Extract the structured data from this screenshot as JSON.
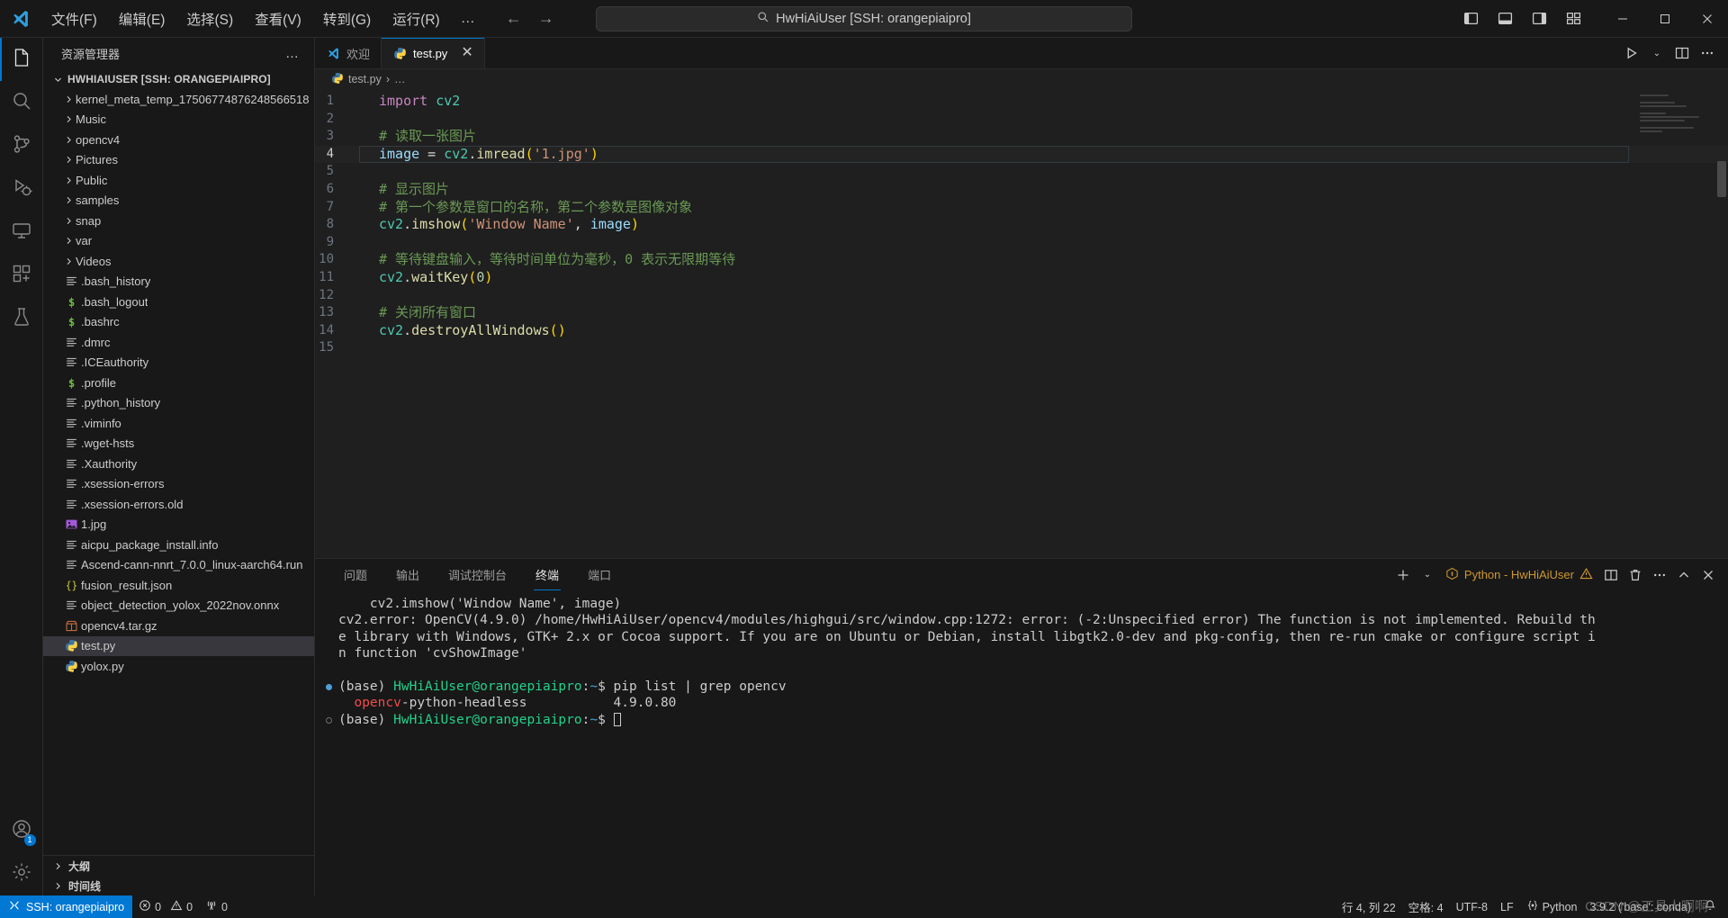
{
  "titlebar": {
    "logo_icon": "vscode-logo-icon",
    "menu": [
      {
        "label": "文件(F)",
        "name": "menu-file"
      },
      {
        "label": "编辑(E)",
        "name": "menu-edit"
      },
      {
        "label": "选择(S)",
        "name": "menu-selection"
      },
      {
        "label": "查看(V)",
        "name": "menu-view"
      },
      {
        "label": "转到(G)",
        "name": "menu-go"
      },
      {
        "label": "运行(R)",
        "name": "menu-run"
      }
    ],
    "menu_more": "…",
    "nav_back": "←",
    "nav_forward": "→",
    "search_text": "HwHiAiUser [SSH: orangepiaipro]",
    "search_placeholder": "HwHiAiUser [SSH: orangepiaipro]",
    "window_controls": {
      "minimize": "–",
      "maximize": "□",
      "close": "✕"
    }
  },
  "activitybar": {
    "items": [
      {
        "name": "explorer",
        "icon": "files-icon",
        "active": true
      },
      {
        "name": "search",
        "icon": "search-icon",
        "active": false
      },
      {
        "name": "source-control",
        "icon": "source-control-icon",
        "active": false
      },
      {
        "name": "run-and-debug",
        "icon": "run-debug-icon",
        "active": false
      },
      {
        "name": "remote-explorer",
        "icon": "remote-explorer-icon",
        "active": false
      },
      {
        "name": "extensions",
        "icon": "extensions-icon",
        "active": false
      },
      {
        "name": "testing",
        "icon": "beaker-icon",
        "active": false
      }
    ],
    "accounts_badge": "1"
  },
  "sidebar": {
    "title": "资源管理器",
    "more_actions": "…",
    "root_label": "HWHIAIUSER [SSH: ORANGEPIAIPRO]",
    "folders": [
      {
        "name": "kernel_meta_temp_17506774876248566518"
      },
      {
        "name": "Music"
      },
      {
        "name": "opencv4"
      },
      {
        "name": "Pictures"
      },
      {
        "name": "Public"
      },
      {
        "name": "samples"
      },
      {
        "name": "snap"
      },
      {
        "name": "var"
      },
      {
        "name": "Videos"
      }
    ],
    "files": [
      {
        "name": ".bash_history",
        "icon": "text-file-icon",
        "selected": false
      },
      {
        "name": ".bash_logout",
        "icon": "shell-file-icon",
        "selected": false
      },
      {
        "name": ".bashrc",
        "icon": "shell-file-icon",
        "selected": false
      },
      {
        "name": ".dmrc",
        "icon": "text-file-icon",
        "selected": false
      },
      {
        "name": ".ICEauthority",
        "icon": "text-file-icon",
        "selected": false
      },
      {
        "name": ".profile",
        "icon": "shell-file-icon",
        "selected": false
      },
      {
        "name": ".python_history",
        "icon": "text-file-icon",
        "selected": false
      },
      {
        "name": ".viminfo",
        "icon": "text-file-icon",
        "selected": false
      },
      {
        "name": ".wget-hsts",
        "icon": "text-file-icon",
        "selected": false
      },
      {
        "name": ".Xauthority",
        "icon": "text-file-icon",
        "selected": false
      },
      {
        "name": ".xsession-errors",
        "icon": "text-file-icon",
        "selected": false
      },
      {
        "name": ".xsession-errors.old",
        "icon": "text-file-icon",
        "selected": false
      },
      {
        "name": "1.jpg",
        "icon": "image-file-icon",
        "selected": false
      },
      {
        "name": "aicpu_package_install.info",
        "icon": "text-file-icon",
        "selected": false
      },
      {
        "name": "Ascend-cann-nnrt_7.0.0_linux-aarch64.run",
        "icon": "text-file-icon",
        "selected": false
      },
      {
        "name": "fusion_result.json",
        "icon": "json-file-icon",
        "selected": false
      },
      {
        "name": "object_detection_yolox_2022nov.onnx",
        "icon": "text-file-icon",
        "selected": false
      },
      {
        "name": "opencv4.tar.gz",
        "icon": "archive-file-icon",
        "selected": false
      },
      {
        "name": "test.py",
        "icon": "python-file-icon",
        "selected": true
      },
      {
        "name": "yolox.py",
        "icon": "python-file-icon",
        "selected": false
      }
    ],
    "sections": [
      {
        "label": "大纲",
        "name": "outline-section"
      },
      {
        "label": "时间线",
        "name": "timeline-section"
      }
    ]
  },
  "editor": {
    "tabs": [
      {
        "label": "欢迎",
        "icon": "vscode-logo-icon",
        "active": false,
        "closable": false
      },
      {
        "label": "test.py",
        "icon": "python-file-icon",
        "active": true,
        "closable": true
      }
    ],
    "tab_close": "✕",
    "actions": [
      {
        "name": "run-python-file-button",
        "icon": "play-icon"
      },
      {
        "name": "run-options-chevron",
        "icon": "chevron-down-icon"
      },
      {
        "name": "split-editor-button",
        "icon": "split-editor-icon"
      },
      {
        "name": "more-actions-button",
        "icon": "ellipsis-icon"
      }
    ],
    "breadcrumb": {
      "file": "test.py",
      "separator": "›",
      "symbol": "…",
      "icon": "python-file-icon"
    },
    "lines": [
      {
        "num": "1",
        "tokens": [
          {
            "t": "import",
            "c": "k"
          },
          {
            "t": " ",
            "c": "p"
          },
          {
            "t": "cv2",
            "c": "id"
          }
        ]
      },
      {
        "num": "2",
        "tokens": []
      },
      {
        "num": "3",
        "tokens": [
          {
            "t": "# 读取一张图片",
            "c": "c"
          }
        ]
      },
      {
        "num": "4",
        "tokens": [
          {
            "t": "image",
            "c": "v"
          },
          {
            "t": " = ",
            "c": "p"
          },
          {
            "t": "cv2",
            "c": "id"
          },
          {
            "t": ".",
            "c": "p"
          },
          {
            "t": "imread",
            "c": "fn"
          },
          {
            "t": "(",
            "c": "br"
          },
          {
            "t": "'1.jpg'",
            "c": "s"
          },
          {
            "t": ")",
            "c": "br"
          }
        ],
        "current": true
      },
      {
        "num": "5",
        "tokens": []
      },
      {
        "num": "6",
        "tokens": [
          {
            "t": "# 显示图片",
            "c": "c"
          }
        ]
      },
      {
        "num": "7",
        "tokens": [
          {
            "t": "# 第一个参数是窗口的名称，第二个参数是图像对象",
            "c": "c"
          }
        ]
      },
      {
        "num": "8",
        "tokens": [
          {
            "t": "cv2",
            "c": "id"
          },
          {
            "t": ".",
            "c": "p"
          },
          {
            "t": "imshow",
            "c": "fn"
          },
          {
            "t": "(",
            "c": "br"
          },
          {
            "t": "'Window Name'",
            "c": "s"
          },
          {
            "t": ", ",
            "c": "p"
          },
          {
            "t": "image",
            "c": "v"
          },
          {
            "t": ")",
            "c": "br"
          }
        ]
      },
      {
        "num": "9",
        "tokens": []
      },
      {
        "num": "10",
        "tokens": [
          {
            "t": "# 等待键盘输入，等待时间单位为毫秒，",
            "c": "c"
          },
          {
            "t": "0",
            "c": "c"
          },
          {
            "t": " 表示无限期等待",
            "c": "c"
          }
        ]
      },
      {
        "num": "11",
        "tokens": [
          {
            "t": "cv2",
            "c": "id"
          },
          {
            "t": ".",
            "c": "p"
          },
          {
            "t": "waitKey",
            "c": "fn"
          },
          {
            "t": "(",
            "c": "br"
          },
          {
            "t": "0",
            "c": "n"
          },
          {
            "t": ")",
            "c": "br"
          }
        ]
      },
      {
        "num": "12",
        "tokens": []
      },
      {
        "num": "13",
        "tokens": [
          {
            "t": "# 关闭所有窗口",
            "c": "c"
          }
        ]
      },
      {
        "num": "14",
        "tokens": [
          {
            "t": "cv2",
            "c": "id"
          },
          {
            "t": ".",
            "c": "p"
          },
          {
            "t": "destroyAllWindows",
            "c": "fn"
          },
          {
            "t": "(",
            "c": "br"
          },
          {
            "t": ")",
            "c": "br"
          }
        ]
      },
      {
        "num": "15",
        "tokens": []
      }
    ]
  },
  "panel": {
    "tabs": [
      {
        "label": "问题",
        "name": "tab-problems",
        "active": false
      },
      {
        "label": "输出",
        "name": "tab-output",
        "active": false
      },
      {
        "label": "调试控制台",
        "name": "tab-debug-console",
        "active": false
      },
      {
        "label": "终端",
        "name": "tab-terminal",
        "active": true
      },
      {
        "label": "端口",
        "name": "tab-ports",
        "active": false
      }
    ],
    "actions": {
      "new_terminal": "+",
      "new_terminal_chevron": "chevron-down-icon",
      "terminal_name": "Python - HwHiAiUser",
      "warning_icon": "warning-icon",
      "split": "split-terminal-icon",
      "kill": "trash-icon",
      "more": "…",
      "maximize": "chevron-up-icon",
      "close": "✕"
    },
    "terminal_lines": [
      {
        "indent": 4,
        "segments": [
          {
            "t": "cv2.imshow('Window Name', image)",
            "c": ""
          }
        ]
      },
      {
        "segments": [
          {
            "t": "cv2.error: OpenCV(4.9.0) /home/HwHiAiUser/opencv4/modules/highgui/src/window.cpp:1272: error: (-2:Unspecified error) The function is not implemented. Rebuild th",
            "c": ""
          }
        ]
      },
      {
        "segments": [
          {
            "t": "e library with Windows, GTK+ 2.x or Cocoa support. If you are on Ubuntu or Debian, install libgtk2.0-dev and pkg-config, then re-run cmake or configure script i",
            "c": ""
          }
        ]
      },
      {
        "segments": [
          {
            "t": "n function 'cvShowImage'",
            "c": ""
          }
        ]
      },
      {
        "segments": []
      },
      {
        "dot": "filled",
        "segments": [
          {
            "t": "(base) ",
            "c": ""
          },
          {
            "t": "HwHiAiUser@orangepiaipro",
            "c": "tg"
          },
          {
            "t": ":",
            "c": ""
          },
          {
            "t": "~",
            "c": "tb2"
          },
          {
            "t": "$ pip list | grep opencv",
            "c": ""
          }
        ]
      },
      {
        "indent": 2,
        "segments": [
          {
            "t": "opencv",
            "c": "tr"
          },
          {
            "t": "-python-headless           4.9.0.80",
            "c": ""
          }
        ]
      },
      {
        "dot": "hollow",
        "segments": [
          {
            "t": "(base) ",
            "c": ""
          },
          {
            "t": "HwHiAiUser@orangepiaipro",
            "c": "tg"
          },
          {
            "t": ":",
            "c": ""
          },
          {
            "t": "~",
            "c": "tb2"
          },
          {
            "t": "$ ",
            "c": ""
          }
        ],
        "cursor": true
      }
    ]
  },
  "statusbar": {
    "remote_label": "SSH: orangepiaipro",
    "remote_icon": "remote-indicator-icon",
    "errors": "0",
    "warnings": "0",
    "ports": "0",
    "cursor_position": "行 4, 列 22",
    "indentation": "空格: 4",
    "encoding": "UTF-8",
    "eol": "LF",
    "language": "Python",
    "interpreter": "3.9.2 ('base': conda)",
    "bell_icon": "bell-icon",
    "watermark": "CSDN @工具人啊啊"
  },
  "colors": {
    "accent": "#0078d4",
    "status_remote_bg": "#0078d4",
    "editor_bg": "#1f1f1f",
    "chrome_bg": "#181818",
    "selected_row": "#37373d"
  }
}
